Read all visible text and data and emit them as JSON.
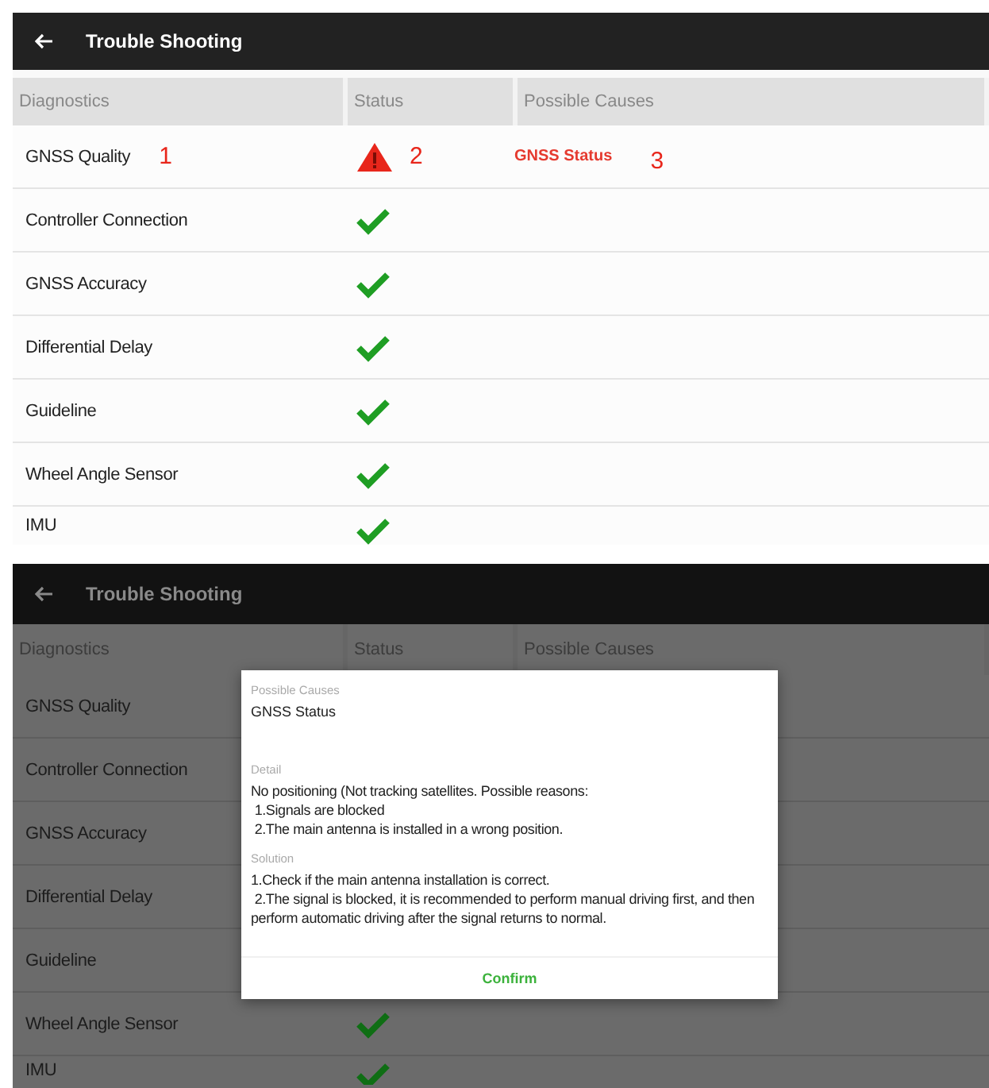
{
  "screens": [
    {
      "title": "Trouble Shooting",
      "dimmed": false,
      "columns": [
        "Diagnostics",
        "Status",
        "Possible Causes"
      ],
      "rows": [
        {
          "diagnostic": "GNSS Quality",
          "passed": false,
          "cause": "GNSS Status",
          "callouts": [
            "1",
            "2",
            "3"
          ]
        },
        {
          "diagnostic": "Controller Connection",
          "passed": true
        },
        {
          "diagnostic": "GNSS Accuracy",
          "passed": true
        },
        {
          "diagnostic": "Differential Delay",
          "passed": true
        },
        {
          "diagnostic": "Guideline",
          "passed": true
        },
        {
          "diagnostic": "Wheel Angle Sensor",
          "passed": true
        },
        {
          "diagnostic": "IMU",
          "passed": true
        }
      ]
    },
    {
      "title": "Trouble Shooting",
      "dimmed": true,
      "columns": [
        "Diagnostics",
        "Status",
        "Possible Causes"
      ],
      "rows": [
        {
          "diagnostic": "GNSS Quality"
        },
        {
          "diagnostic": "Controller Connection"
        },
        {
          "diagnostic": "GNSS Accuracy"
        },
        {
          "diagnostic": "Differential Delay"
        },
        {
          "diagnostic": "Guideline"
        },
        {
          "diagnostic": "Wheel Angle Sensor",
          "passed": true
        },
        {
          "diagnostic": "IMU",
          "passed": true
        }
      ],
      "dialog": {
        "cause_label": "Possible Causes",
        "cause": "GNSS Status",
        "detail_label": "Detail",
        "detail": "No positioning (Not tracking satellites. Possible reasons:\n 1.Signals are blocked\n 2.The main antenna is installed in a wrong position.",
        "solution_label": "Solution",
        "solution": "1.Check if the main antenna installation is correct.\n 2.The signal is blocked, it is recommended to perform manual driving first, and then perform automatic driving after the signal returns to normal.",
        "button": "Confirm"
      }
    }
  ]
}
